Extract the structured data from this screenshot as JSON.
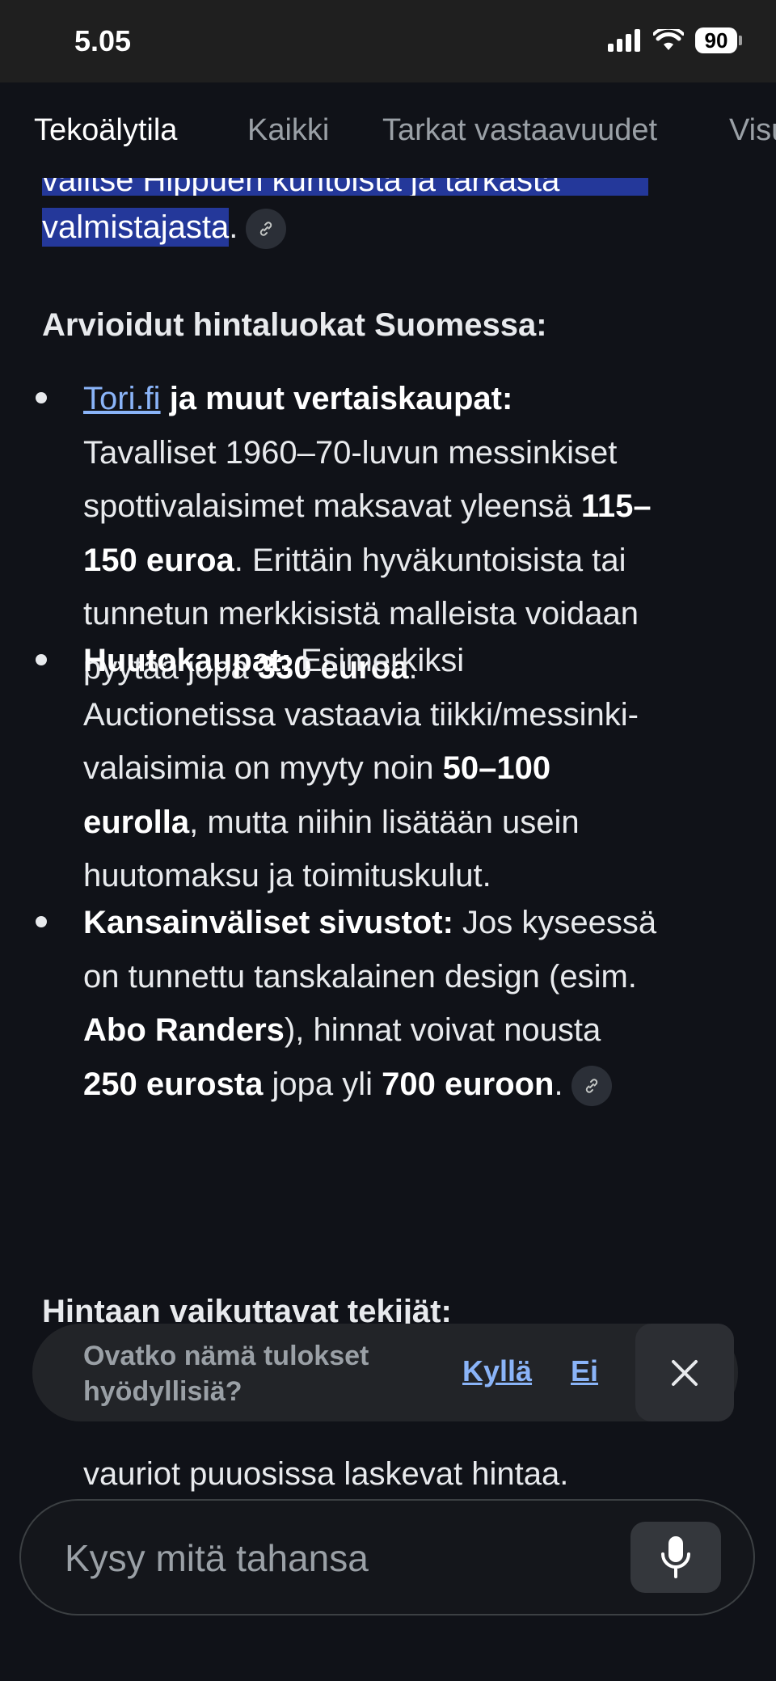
{
  "status_bar": {
    "time": "5.05",
    "battery": "90"
  },
  "tabs": [
    "Tekoälytila",
    "Kaikki",
    "Tarkat vastaavuudet",
    "Visu"
  ],
  "top_paragraph": {
    "clipped_line": "valitse Hippuen kuntoista ja tarkasta",
    "highlight_text": "valmistajasta",
    "trailing": "."
  },
  "heading": "Arvioidut hintaluokat Suomessa:",
  "items": [
    {
      "link": "Tori.fi",
      "title": " ja muut vertaiskaupat:",
      "lines": [
        "Tavalliset 1960–70-luvun messinkiset",
        "spottivalaisimet maksavat yleensä <b>115–</b>",
        "<b>150 euroa</b>. Erittäin hyväkuntoisista tai",
        "tunnetun merkkisistä malleista voidaan",
        "pyytää jopa <b>330 euroa</b>."
      ]
    },
    {
      "title": "Huutokaupat:",
      "lines": [
        " Esimerkiksi",
        "Auctionetissa vastaavia tiikki/messinki-",
        "valaisimia on myyty noin <b>50–100</b>",
        "<b>eurolla</b>, mutta niihin lisätään usein",
        "huutomaksu ja toimituskulut."
      ]
    },
    {
      "title": "Kansainväliset sivustot:",
      "lines": [
        " Jos kyseessä",
        "on tunnettu tanskalainen design (esim.",
        "<b>Abo Randers</b>), hinnat voivat nousta",
        "<b>250 eurosta</b> jopa yli <b>700 euroon</b>."
      ]
    }
  ],
  "heading2": "Hintaan vaikuttavat tekijät:",
  "bottom_line": "vauriot puuosissa laskevat hintaa.",
  "feedback": {
    "question": "Ovatko nämä tulokset hyödyllisiä?",
    "yes": "Kyllä",
    "no": "Ei"
  },
  "input": {
    "placeholder": "Kysy mitä tahansa"
  },
  "icons": [
    "signal-icon",
    "wifi-icon",
    "battery-icon",
    "link-icon",
    "close-icon",
    "mic-icon"
  ]
}
